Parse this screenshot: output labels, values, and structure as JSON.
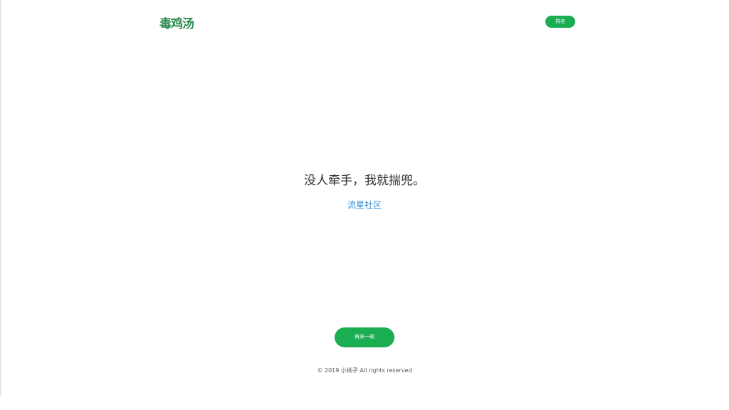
{
  "header": {
    "logo_text": "毒鸡汤",
    "action_label": "排名"
  },
  "content": {
    "quote": "没人牵手，我就揣兜。",
    "source": "流星社区"
  },
  "actions": {
    "next_label": "再来一碗"
  },
  "footer": {
    "copyright": "© 2019 小桃子 All rights reserved"
  },
  "colors": {
    "accent": "#1aad52",
    "logo": "#2e8a4f",
    "link": "#2f8dd6",
    "text": "#333333",
    "background": "#ffffff"
  }
}
